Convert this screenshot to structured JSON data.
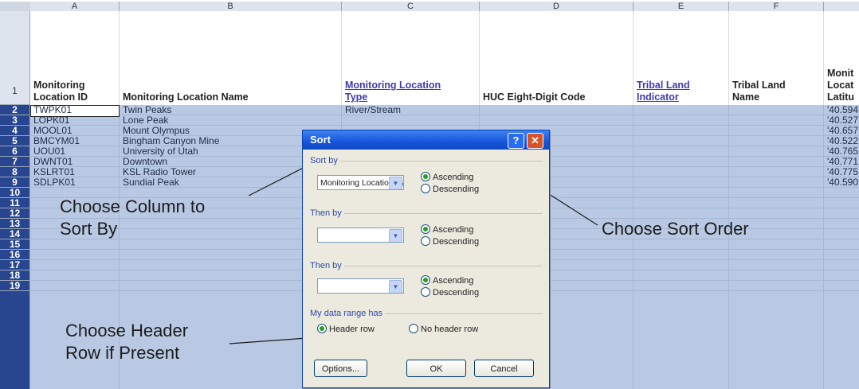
{
  "columns": [
    "A",
    "B",
    "C",
    "D",
    "E",
    "F",
    ""
  ],
  "rows": [
    "1",
    "2",
    "3",
    "4",
    "5",
    "6",
    "7",
    "8",
    "9",
    "10",
    "11",
    "12",
    "13",
    "14",
    "15",
    "16",
    "17",
    "18",
    "19"
  ],
  "headers": {
    "a_line1": "Monitoring",
    "a_line2": "Location ID",
    "b": "Monitoring Location Name",
    "c_line1": "Monitoring Location",
    "c_line2": "Type",
    "d": "HUC Eight-Digit Code",
    "e_line1": "Tribal Land",
    "e_line2": "Indicator",
    "f_line1": "Tribal Land",
    "f_line2": "Name",
    "g_line1": "Monit",
    "g_line2": "Locat",
    "g_line3": "Latitu"
  },
  "data": [
    {
      "id": "TWPK01",
      "name": "Twin Peaks",
      "type": "River/Stream",
      "lat": "'40.594"
    },
    {
      "id": "LOPK01",
      "name": "Lone Peak",
      "type": "",
      "lat": "'40.527"
    },
    {
      "id": "MOOL01",
      "name": "Mount Olympus",
      "type": "",
      "lat": "'40.657"
    },
    {
      "id": "BMCYM01",
      "name": "Bingham Canyon Mine",
      "type": "",
      "lat": "'40.522"
    },
    {
      "id": "UOU01",
      "name": "University of Utah",
      "type": "",
      "lat": "'40.765"
    },
    {
      "id": "DWNT01",
      "name": "Downtown",
      "type": "",
      "lat": "'40.771"
    },
    {
      "id": "KSLRT01",
      "name": "KSL Radio Tower",
      "type": "",
      "lat": "'40.775"
    },
    {
      "id": "SDLPK01",
      "name": "Sundial Peak",
      "type": "",
      "lat": "'40.590"
    }
  ],
  "callouts": {
    "column_line1": "Choose Column to",
    "column_line2": "Sort By",
    "header_line1": "Choose Header",
    "header_line2": "Row if Present",
    "order": "Choose Sort Order"
  },
  "dialog": {
    "title": "Sort",
    "help_glyph": "?",
    "close_glyph": "✕",
    "sort_by_label": "Sort by",
    "sort_by_value": "Monitoring Location Type",
    "then_by_1_label": "Then by",
    "then_by_1_value": "",
    "then_by_2_label": "Then by",
    "then_by_2_value": "",
    "ascending": "Ascending",
    "descending": "Descending",
    "range_label": "My data range has",
    "header_row": "Header row",
    "no_header_row": "No header row",
    "options_button": "Options...",
    "ok_button": "OK",
    "cancel_button": "Cancel",
    "combo_arrow": "▼"
  }
}
